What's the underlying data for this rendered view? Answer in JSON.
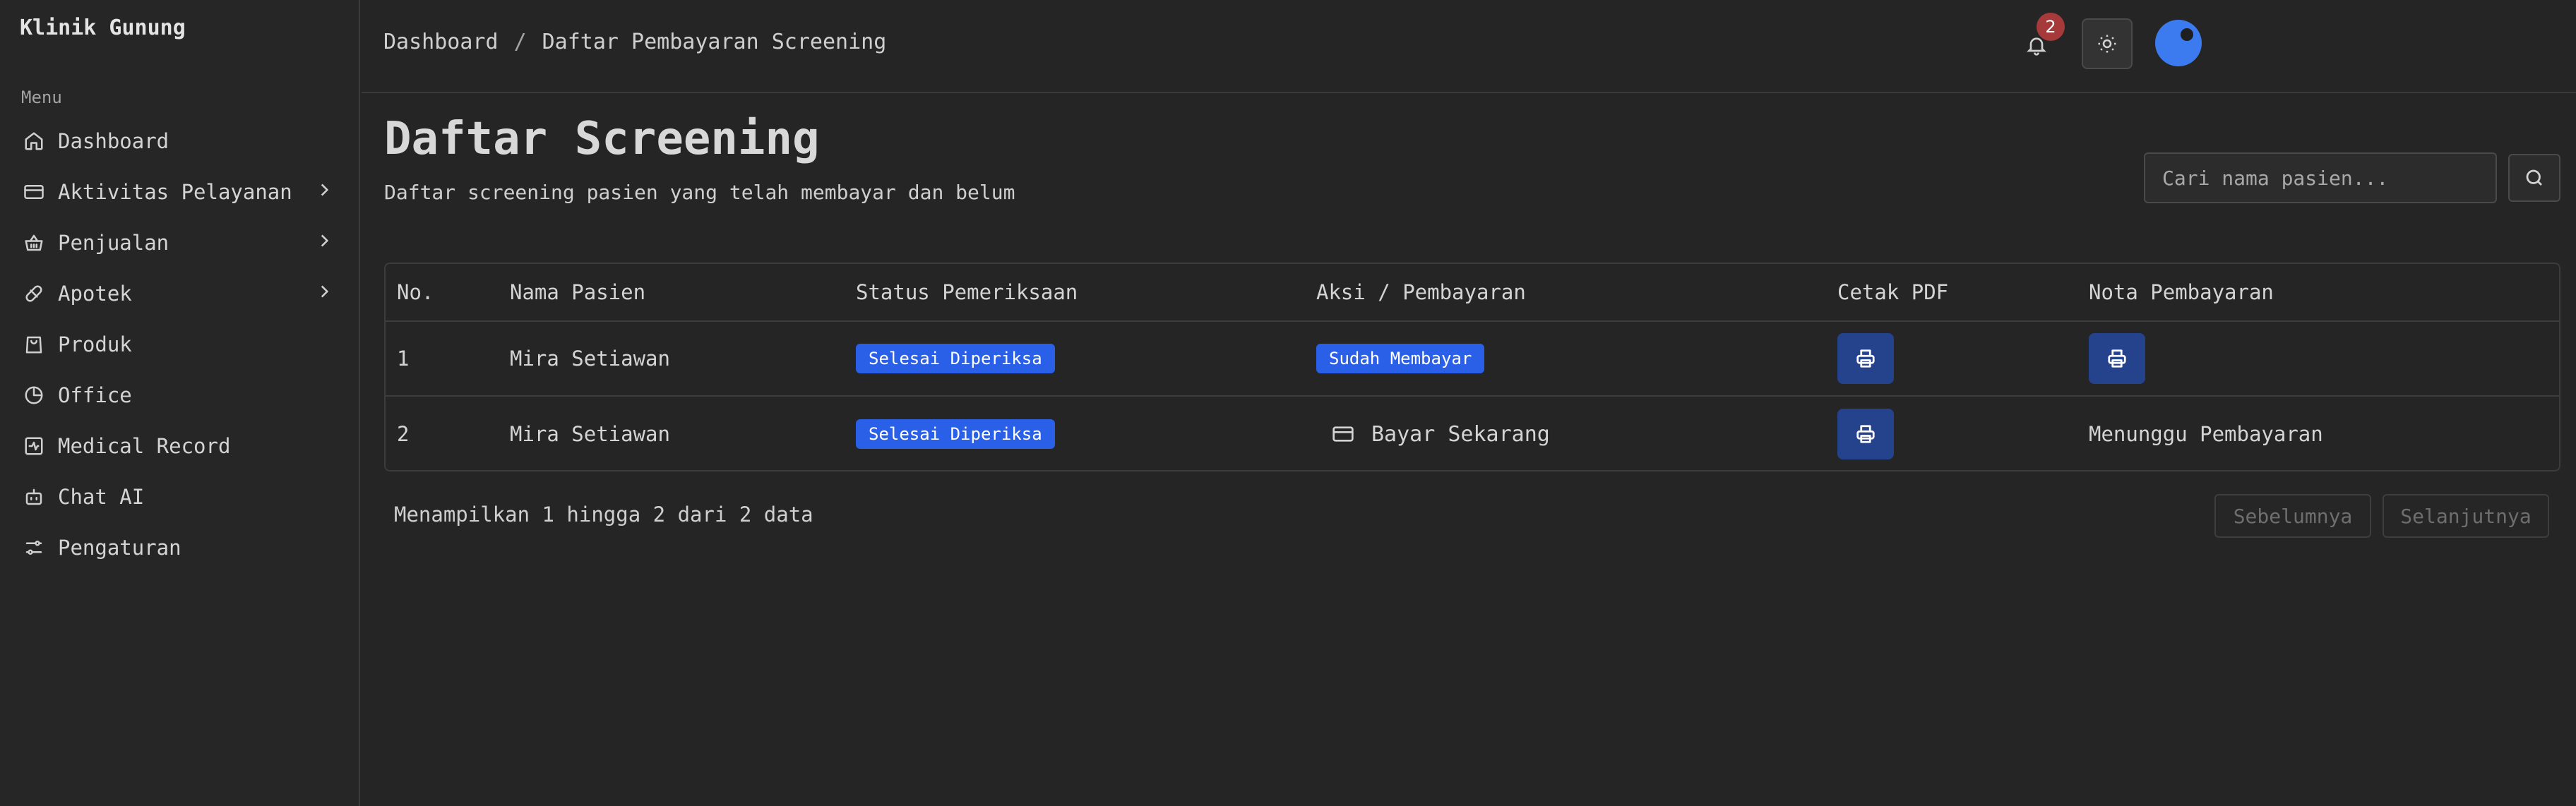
{
  "sidebar": {
    "brand": "Klinik Gunung",
    "menu_label": "Menu",
    "items": [
      {
        "label": "Dashboard",
        "icon": "home-icon",
        "has_chevron": false
      },
      {
        "label": "Aktivitas Pelayanan",
        "icon": "credit-card-icon",
        "has_chevron": true
      },
      {
        "label": "Penjualan",
        "icon": "basket-icon",
        "has_chevron": true
      },
      {
        "label": "Apotek",
        "icon": "pill-icon",
        "has_chevron": true
      },
      {
        "label": "Produk",
        "icon": "shopping-bag-icon",
        "has_chevron": false
      },
      {
        "label": "Office",
        "icon": "pie-chart-icon",
        "has_chevron": false
      },
      {
        "label": "Medical Record",
        "icon": "activity-square-icon",
        "has_chevron": false
      },
      {
        "label": "Chat AI",
        "icon": "bot-icon",
        "has_chevron": false
      },
      {
        "label": "Pengaturan",
        "icon": "sliders-icon",
        "has_chevron": false
      }
    ]
  },
  "header": {
    "breadcrumb": [
      "Dashboard",
      "Daftar Pembayaran Screening"
    ],
    "breadcrumb_separator": "/",
    "notification_count": "2",
    "icons": [
      "bell-icon",
      "sun-icon",
      "avatar"
    ],
    "avatar_color": "#3b7bef"
  },
  "page": {
    "title": "Daftar Screening",
    "subtitle": "Daftar screening pasien yang telah membayar dan belum",
    "search_placeholder": "Cari nama pasien..."
  },
  "table": {
    "columns": [
      "No.",
      "Nama Pasien",
      "Status Pemeriksaan",
      "Aksi / Pembayaran",
      "Cetak PDF",
      "Nota Pembayaran"
    ],
    "rows": [
      {
        "no": "1",
        "name": "Mira Setiawan",
        "status": "Selesai Diperiksa",
        "action": "Sudah Membayar",
        "action_type": "badge",
        "nota": "print",
        "nota_text": ""
      },
      {
        "no": "2",
        "name": "Mira Setiawan",
        "status": "Selesai Diperiksa",
        "action": "Bayar Sekarang",
        "action_type": "link",
        "nota": "text",
        "nota_text": "Menunggu Pembayaran"
      }
    ]
  },
  "pagination": {
    "info": "Menampilkan 1 hingga 2 dari 2 data",
    "prev_label": "Sebelumnya",
    "next_label": "Selanjutnya"
  },
  "colors": {
    "background": "#252525",
    "badge_blue": "#2a5fe8",
    "print_button": "#25428d",
    "notification_badge": "#a63a3a"
  }
}
